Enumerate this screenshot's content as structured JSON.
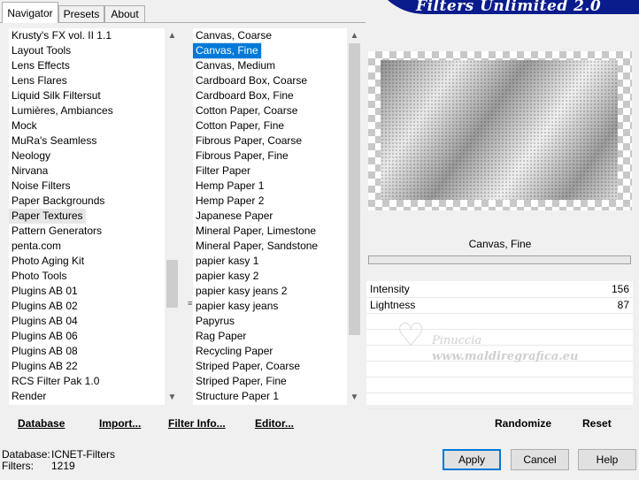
{
  "tabs": [
    "Navigator",
    "Presets",
    "About"
  ],
  "banner_title": "Filters Unlimited 2.0",
  "left_list": {
    "items": [
      "Krusty's FX vol. II 1.1",
      "Layout Tools",
      "Lens Effects",
      "Lens Flares",
      "Liquid Silk Filtersut",
      "Lumières, Ambiances",
      "Mock",
      "MuRa's Seamless",
      "Neology",
      "Nirvana",
      "Noise Filters",
      "Paper Backgrounds",
      "Paper Textures",
      "Pattern Generators",
      "penta.com",
      "Photo Aging Kit",
      "Photo Tools",
      "Plugins AB 01",
      "Plugins AB 02",
      "Plugins AB 04",
      "Plugins AB 06",
      "Plugins AB 08",
      "Plugins AB 22",
      "RCS Filter Pak 1.0",
      "Render"
    ],
    "selected_index": 12
  },
  "right_list": {
    "items": [
      "Canvas, Coarse",
      "Canvas, Fine",
      "Canvas, Medium",
      "Cardboard Box, Coarse",
      "Cardboard Box, Fine",
      "Cotton Paper, Coarse",
      "Cotton Paper, Fine",
      "Fibrous Paper, Coarse",
      "Fibrous Paper, Fine",
      "Filter Paper",
      "Hemp Paper 1",
      "Hemp Paper 2",
      "Japanese Paper",
      "Mineral Paper, Limestone",
      "Mineral Paper, Sandstone",
      "papier kasy 1",
      "papier kasy 2",
      "papier kasy jeans 2",
      "papier kasy jeans",
      "Papyrus",
      "Rag Paper",
      "Recycling Paper",
      "Striped Paper, Coarse",
      "Striped Paper, Fine",
      "Structure Paper 1"
    ],
    "selected_index": 1
  },
  "filter_name": "Canvas, Fine",
  "params": [
    {
      "label": "Intensity",
      "value": "156"
    },
    {
      "label": "Lightness",
      "value": "87"
    }
  ],
  "watermark": {
    "line1": "Pinuccia",
    "line2": "www.maldiregrafica.eu"
  },
  "left_buttons": {
    "database": "Database",
    "import": "Import...",
    "filter_info": "Filter Info...",
    "editor": "Editor..."
  },
  "right_buttons": {
    "randomize": "Randomize",
    "reset": "Reset"
  },
  "status": {
    "database_label": "Database:",
    "database_value": "ICNET-Filters",
    "filters_label": "Filters:",
    "filters_value": "1219"
  },
  "dialog_buttons": {
    "apply": "Apply",
    "cancel": "Cancel",
    "help": "Help"
  },
  "colors": {
    "accent": "#0078d7",
    "banner": "#0a1c8c"
  }
}
